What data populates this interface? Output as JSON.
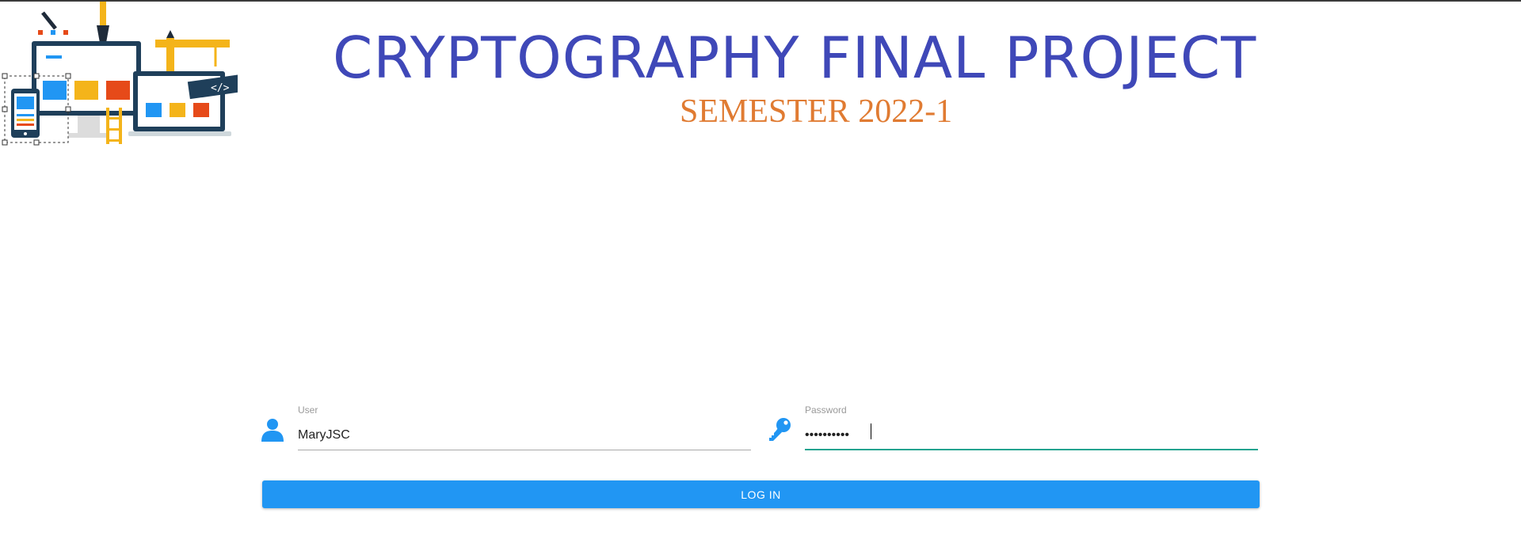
{
  "header": {
    "title": "CRYPTOGRAPHY FINAL PROJECT",
    "subtitle": "SEMESTER 2022-1",
    "logo_icon": "web-design-illustration-icon"
  },
  "login_form": {
    "user": {
      "label": "User",
      "value": "MaryJSC",
      "icon": "user-icon"
    },
    "password": {
      "label": "Password",
      "value": "••••••••••",
      "icon": "key-icon",
      "focused": true
    },
    "login_button_label": "LOG IN"
  },
  "colors": {
    "title": "#3f48b8",
    "subtitle": "#e07b32",
    "accent": "#2196f3",
    "focus_underline": "#24a38f"
  }
}
